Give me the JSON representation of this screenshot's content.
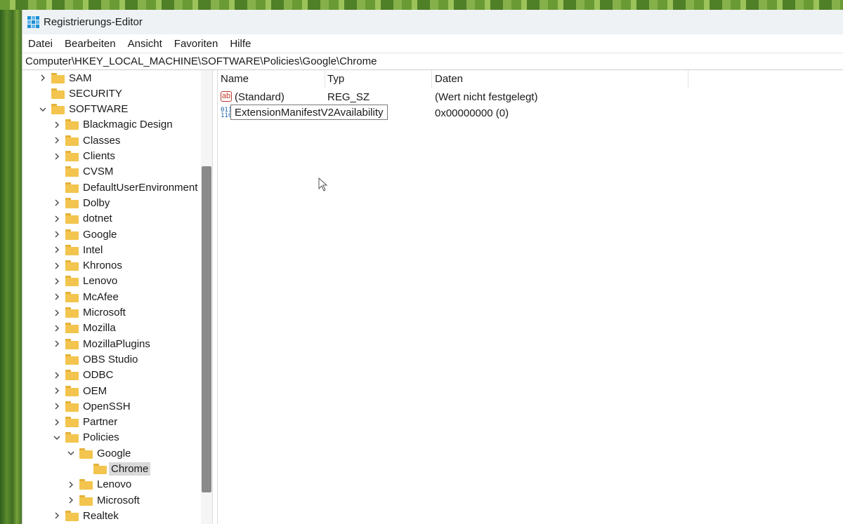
{
  "window": {
    "title": "Registrierungs-Editor"
  },
  "menu": [
    "Datei",
    "Bearbeiten",
    "Ansicht",
    "Favoriten",
    "Hilfe"
  ],
  "address": "Computer\\HKEY_LOCAL_MACHINE\\SOFTWARE\\Policies\\Google\\Chrome",
  "tree": [
    {
      "label": "SAM",
      "level": 1,
      "chevron": "right"
    },
    {
      "label": "SECURITY",
      "level": 1,
      "chevron": "none"
    },
    {
      "label": "SOFTWARE",
      "level": 1,
      "chevron": "down"
    },
    {
      "label": "Blackmagic Design",
      "level": 2,
      "chevron": "right"
    },
    {
      "label": "Classes",
      "level": 2,
      "chevron": "right"
    },
    {
      "label": "Clients",
      "level": 2,
      "chevron": "right"
    },
    {
      "label": "CVSM",
      "level": 2,
      "chevron": "none"
    },
    {
      "label": "DefaultUserEnvironment",
      "level": 2,
      "chevron": "none"
    },
    {
      "label": "Dolby",
      "level": 2,
      "chevron": "right"
    },
    {
      "label": "dotnet",
      "level": 2,
      "chevron": "right"
    },
    {
      "label": "Google",
      "level": 2,
      "chevron": "right"
    },
    {
      "label": "Intel",
      "level": 2,
      "chevron": "right"
    },
    {
      "label": "Khronos",
      "level": 2,
      "chevron": "right"
    },
    {
      "label": "Lenovo",
      "level": 2,
      "chevron": "right"
    },
    {
      "label": "McAfee",
      "level": 2,
      "chevron": "right"
    },
    {
      "label": "Microsoft",
      "level": 2,
      "chevron": "right"
    },
    {
      "label": "Mozilla",
      "level": 2,
      "chevron": "right"
    },
    {
      "label": "MozillaPlugins",
      "level": 2,
      "chevron": "right"
    },
    {
      "label": "OBS Studio",
      "level": 2,
      "chevron": "none"
    },
    {
      "label": "ODBC",
      "level": 2,
      "chevron": "right"
    },
    {
      "label": "OEM",
      "level": 2,
      "chevron": "right"
    },
    {
      "label": "OpenSSH",
      "level": 2,
      "chevron": "right"
    },
    {
      "label": "Partner",
      "level": 2,
      "chevron": "right"
    },
    {
      "label": "Policies",
      "level": 2,
      "chevron": "down"
    },
    {
      "label": "Google",
      "level": 3,
      "chevron": "down"
    },
    {
      "label": "Chrome",
      "level": 4,
      "chevron": "none",
      "selected": true
    },
    {
      "label": "Lenovo",
      "level": 3,
      "chevron": "right"
    },
    {
      "label": "Microsoft",
      "level": 3,
      "chevron": "right"
    },
    {
      "label": "Realtek",
      "level": 2,
      "chevron": "right"
    }
  ],
  "columns": {
    "name": "Name",
    "type": "Typ",
    "data": "Daten"
  },
  "values": [
    {
      "name": "(Standard)",
      "type": "REG_SZ",
      "data": "(Wert nicht festgelegt)",
      "icon": "string-value-icon",
      "icon_text": "ab"
    },
    {
      "name": "ExtensionManifestV2Availability",
      "type": "",
      "data": "0x00000000 (0)",
      "icon": "binary-value-icon",
      "icon_text": "011\n110",
      "editing": true
    }
  ],
  "colors": {
    "folder": "#f3c54e",
    "selection": "#d9d9d9",
    "scroll_thumb": "#8a8a8a"
  }
}
